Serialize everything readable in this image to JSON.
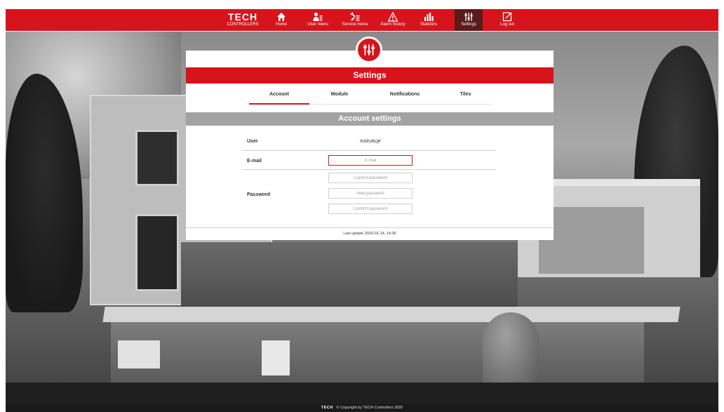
{
  "brand": {
    "logo": "TECH",
    "subtitle": "CONTROLLERS",
    "accent_color": "#d7141c"
  },
  "nav": {
    "items": [
      {
        "label": "Home",
        "icon": "home-icon"
      },
      {
        "label": "User menu",
        "icon": "user-menu-icon"
      },
      {
        "label": "Service menu",
        "icon": "service-menu-icon"
      },
      {
        "label": "Alarm history",
        "icon": "alarm-icon"
      },
      {
        "label": "Statistics",
        "icon": "statistics-icon"
      },
      {
        "label": "Settings",
        "icon": "settings-icon",
        "active": true
      },
      {
        "label": "Log out",
        "icon": "logout-icon"
      }
    ]
  },
  "panel": {
    "title": "Settings",
    "badge_icon": "settings-sliders-icon",
    "tabs": [
      {
        "label": "Account",
        "active": true
      },
      {
        "label": "Module"
      },
      {
        "label": "Notifications"
      },
      {
        "label": "Tiles"
      }
    ],
    "section_title": "Account settings",
    "user": {
      "label": "User",
      "value": "instrukcje"
    },
    "email": {
      "label": "E-mail",
      "placeholder": "E-mail"
    },
    "password": {
      "label": "Password",
      "current_placeholder": "Current password",
      "new_placeholder": "New password",
      "confirm_placeholder": "Confirm password"
    },
    "last_update": "Last update 2020-01-14, 14:36"
  },
  "footer": {
    "logo": "TECH",
    "text": "© Copyright by TECH Controllers 2020"
  }
}
